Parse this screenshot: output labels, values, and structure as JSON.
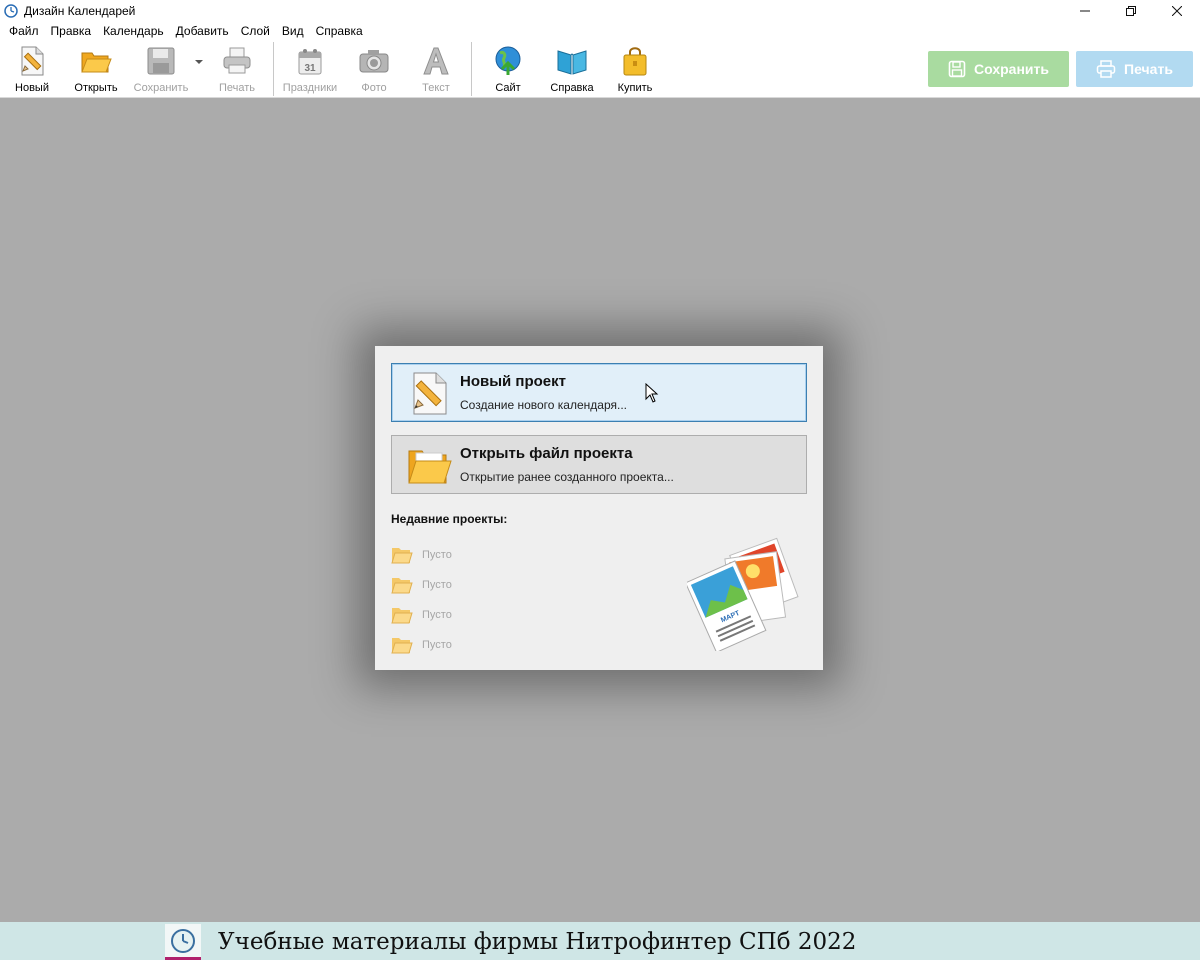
{
  "window": {
    "title": "Дизайн Календарей"
  },
  "menu": [
    "Файл",
    "Правка",
    "Календарь",
    "Добавить",
    "Слой",
    "Вид",
    "Справка"
  ],
  "toolbar": {
    "new": "Новый",
    "open": "Открыть",
    "save": "Сохранить",
    "print": "Печать",
    "holidays": "Праздники",
    "photo": "Фото",
    "text": "Текст",
    "site": "Сайт",
    "help": "Справка",
    "buy": "Купить",
    "save_big": "Сохранить",
    "print_big": "Печать",
    "calendar_icon_number": "31"
  },
  "dialog": {
    "new_project": {
      "title": "Новый проект",
      "subtitle": "Создание нового календаря..."
    },
    "open_project": {
      "title": "Открыть файл проекта",
      "subtitle": "Открытие ранее созданного проекта..."
    },
    "recent_title": "Недавние проекты:",
    "recent": [
      "Пусто",
      "Пусто",
      "Пусто",
      "Пусто"
    ],
    "illustration_caption": "МАРТ"
  },
  "banner": {
    "text": "Учебные материалы фирмы Нитрофинтер СПб 2022"
  },
  "colors": {
    "workspace": "#ababab",
    "save_button": "#a9dba0",
    "print_button": "#b2daf1",
    "selected_action_border": "#3c7fb1",
    "banner_bg": "#cfe6e6"
  }
}
